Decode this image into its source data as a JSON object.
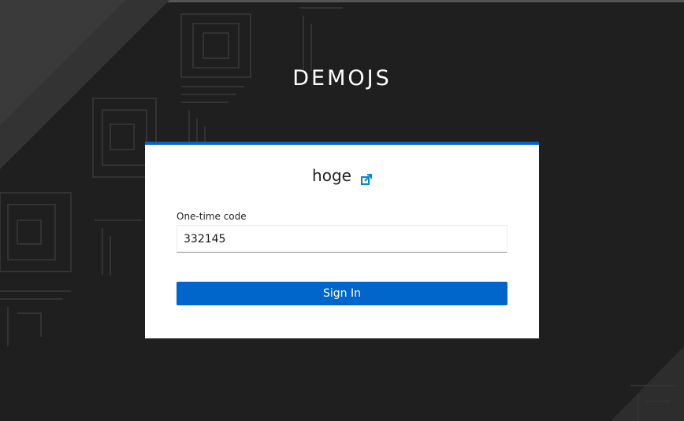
{
  "brand": {
    "title": "DEMOJS"
  },
  "login": {
    "username": "hoge",
    "restart_icon": "external-link-icon",
    "otp_label": "One-time code",
    "otp_value": "332145",
    "submit_label": "Sign In"
  },
  "colors": {
    "accent": "#0066cc",
    "background": "#1f1f1f",
    "card": "#ffffff"
  }
}
